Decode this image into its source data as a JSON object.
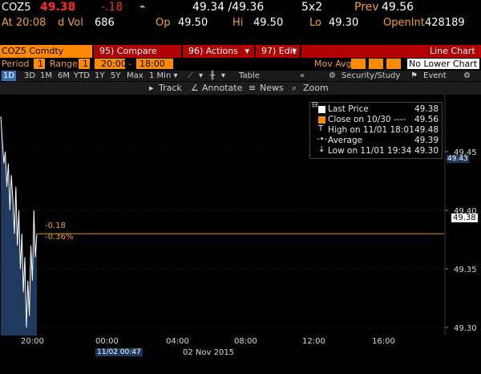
{
  "quote": {
    "ticker": "COZ5",
    "last": "49.38",
    "change": "-.18",
    "bid_ask": "49.34 /49.36",
    "size": "5x2",
    "prev_label": "Prev",
    "prev": "49.56",
    "time": "At 20:08",
    "vol_label": "d Vol",
    "vol": "686",
    "open_label": "Op",
    "open": "49.50",
    "high_label": "Hi",
    "high": "49.50",
    "low_label": "Lo",
    "low": "49.30",
    "oi_label": "OpenInt",
    "oi": "428189"
  },
  "toolbar": {
    "security": "COZ5 Comdty",
    "compare": "95) Compare",
    "actions": "96) Actions",
    "edit": "97) Edit",
    "title": "Line Chart"
  },
  "params": {
    "period_label": "Period",
    "period_value": "1",
    "range_label": "Range",
    "range_value": "1",
    "start_time": "20:00",
    "dash": "-",
    "end_time": "18:00",
    "mov_avg_label": "Mov Avg",
    "lower_chart": "No Lower Chart"
  },
  "periods": {
    "items": [
      "1D",
      "3D",
      "1M",
      "6M",
      "YTD",
      "1Y",
      "5Y",
      "Max"
    ],
    "selected": "1D",
    "interval": "1 Min",
    "table": "Table",
    "security_study": "Security/Study",
    "event": "Event"
  },
  "icons_bar": {
    "track": "Track",
    "annotate": "Annotate",
    "news": "News",
    "zoom": "Zoom"
  },
  "legend": {
    "items": [
      {
        "label": "Last Price",
        "value": "49.38"
      },
      {
        "label": "Close on 10/30 ----",
        "value": "49.56"
      },
      {
        "label": "High on 11/01 18:01",
        "value": "49.48"
      },
      {
        "label": "Average",
        "value": "49.39"
      },
      {
        "label": "Low on 11/01 19:34",
        "value": "49.30"
      }
    ]
  },
  "chart_data": {
    "type": "area",
    "y_ticks": [
      "49.45",
      "49.40",
      "49.35",
      "49.30"
    ],
    "ylim": [
      49.28,
      49.5
    ],
    "x_ticks": [
      "20:00",
      "00:00",
      "04:00",
      "08:00",
      "12:00",
      "16:00"
    ],
    "date_label": "02 Nov 2015",
    "cursor_time": "11/02 00:47",
    "last_price_tag": "49.38",
    "average_tag": "49.43",
    "change_annotation": "-0.18",
    "change_pct_annotation": "-0.36%",
    "reference_line": 49.38,
    "series": [
      {
        "x": [
          0,
          1,
          2,
          3,
          4,
          5,
          6,
          7,
          8,
          9,
          10,
          11,
          12,
          13,
          14,
          15,
          16,
          17,
          18,
          19,
          20,
          21,
          22,
          23,
          24
        ],
        "values": [
          49.48,
          49.46,
          49.44,
          49.45,
          49.42,
          49.44,
          49.4,
          49.43,
          49.41,
          49.38,
          49.42,
          49.37,
          49.4,
          49.35,
          49.38,
          49.33,
          49.36,
          49.3,
          49.34,
          49.31,
          49.37,
          49.34,
          49.4,
          49.36,
          49.38
        ]
      }
    ]
  },
  "colors": {
    "amber": "#f0a030",
    "red_bar": "#b00000",
    "orange": "#ff8a00",
    "series_fill": "#1f3a5e",
    "reference_line": "#e08a20"
  }
}
